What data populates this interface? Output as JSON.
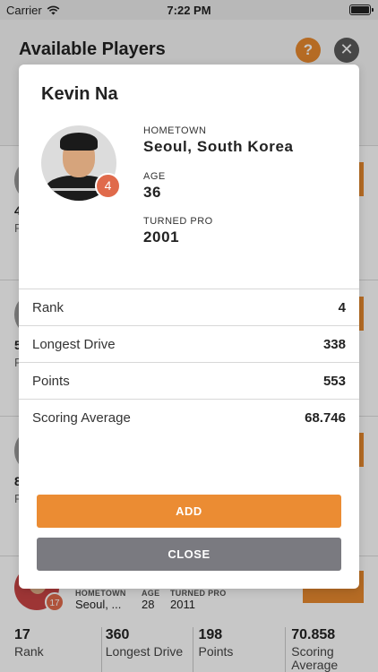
{
  "status_bar": {
    "carrier": "Carrier",
    "time": "7:22 PM"
  },
  "background": {
    "title": "Available Players",
    "help_label": "?",
    "close_label": "✕",
    "card_stubs": [
      {
        "num": "4",
        "label": "R"
      },
      {
        "num": "5",
        "label": "R"
      },
      {
        "num": "8",
        "label": "R"
      }
    ],
    "player": {
      "rank_badge": "17",
      "labels": {
        "hometown": "HOMETOWN",
        "age": "AGE",
        "turned_pro": "TURNED PRO"
      },
      "hometown": "Seoul, ...",
      "age": "28",
      "turned_pro": "2011"
    },
    "stats": [
      {
        "value": "17",
        "label": "Rank"
      },
      {
        "value": "360",
        "label": "Longest Drive"
      },
      {
        "value": "198",
        "label": "Points"
      },
      {
        "value": "70.858",
        "label": "Scoring Average"
      }
    ]
  },
  "modal": {
    "name": "Kevin Na",
    "rank_badge": "4",
    "labels": {
      "hometown": "HOMETOWN",
      "age": "AGE",
      "turned_pro": "TURNED PRO"
    },
    "hometown": "Seoul, South Korea",
    "age": "36",
    "turned_pro": "2001",
    "stats": [
      {
        "label": "Rank",
        "value": "4"
      },
      {
        "label": "Longest Drive",
        "value": "338"
      },
      {
        "label": "Points",
        "value": "553"
      },
      {
        "label": "Scoring Average",
        "value": "68.746"
      }
    ],
    "add_label": "ADD",
    "close_label": "CLOSE"
  },
  "colors": {
    "accent": "#eb8c33",
    "badge": "#e06a4b",
    "close_button": "#7a7a80"
  }
}
